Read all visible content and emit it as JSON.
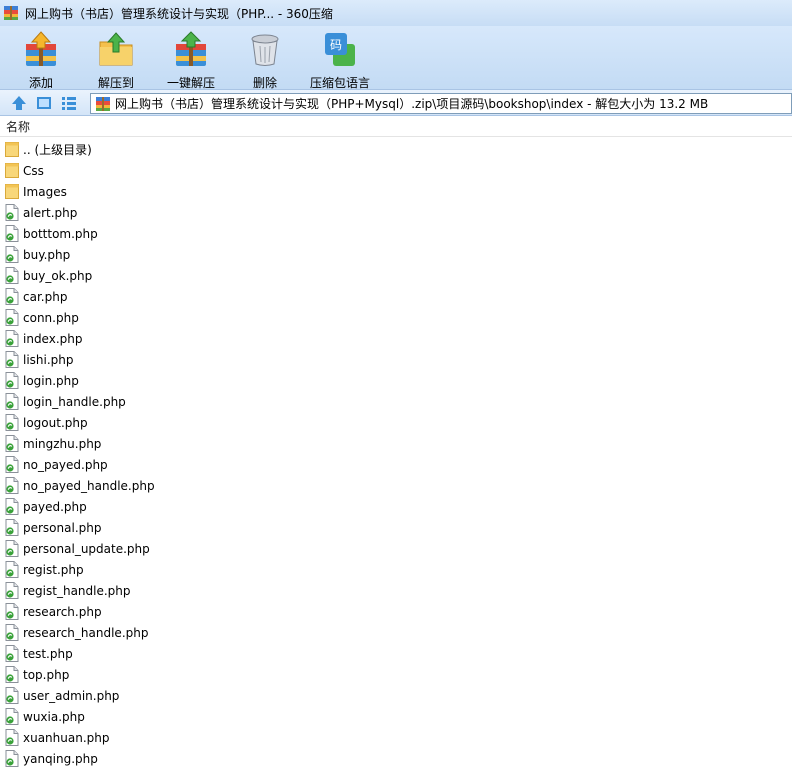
{
  "window": {
    "title": "网上购书（书店）管理系统设计与实现（PHP... - 360压缩"
  },
  "toolbar": {
    "add_label": "添加",
    "extract_to_label": "解压到",
    "one_click_extract_label": "一键解压",
    "delete_label": "删除",
    "encoding_label": "压缩包语言"
  },
  "address": {
    "path": "网上购书（书店）管理系统设计与实现（PHP+Mysql）.zip\\项目源码\\bookshop\\index - 解包大小为 13.2 MB"
  },
  "list": {
    "column_name": "名称",
    "items": [
      {
        "name": ".. (上级目录)",
        "type": "folder"
      },
      {
        "name": "Css",
        "type": "folder"
      },
      {
        "name": "Images",
        "type": "folder"
      },
      {
        "name": "alert.php",
        "type": "php"
      },
      {
        "name": "botttom.php",
        "type": "php"
      },
      {
        "name": "buy.php",
        "type": "php"
      },
      {
        "name": "buy_ok.php",
        "type": "php"
      },
      {
        "name": "car.php",
        "type": "php"
      },
      {
        "name": "conn.php",
        "type": "php"
      },
      {
        "name": "index.php",
        "type": "php"
      },
      {
        "name": "lishi.php",
        "type": "php"
      },
      {
        "name": "login.php",
        "type": "php"
      },
      {
        "name": "login_handle.php",
        "type": "php"
      },
      {
        "name": "logout.php",
        "type": "php"
      },
      {
        "name": "mingzhu.php",
        "type": "php"
      },
      {
        "name": "no_payed.php",
        "type": "php"
      },
      {
        "name": "no_payed_handle.php",
        "type": "php"
      },
      {
        "name": "payed.php",
        "type": "php"
      },
      {
        "name": "personal.php",
        "type": "php"
      },
      {
        "name": "personal_update.php",
        "type": "php"
      },
      {
        "name": "regist.php",
        "type": "php"
      },
      {
        "name": "regist_handle.php",
        "type": "php"
      },
      {
        "name": "research.php",
        "type": "php"
      },
      {
        "name": "research_handle.php",
        "type": "php"
      },
      {
        "name": "test.php",
        "type": "php"
      },
      {
        "name": "top.php",
        "type": "php"
      },
      {
        "name": "user_admin.php",
        "type": "php"
      },
      {
        "name": "wuxia.php",
        "type": "php"
      },
      {
        "name": "xuanhuan.php",
        "type": "php"
      },
      {
        "name": "yanqing.php",
        "type": "php"
      }
    ]
  }
}
